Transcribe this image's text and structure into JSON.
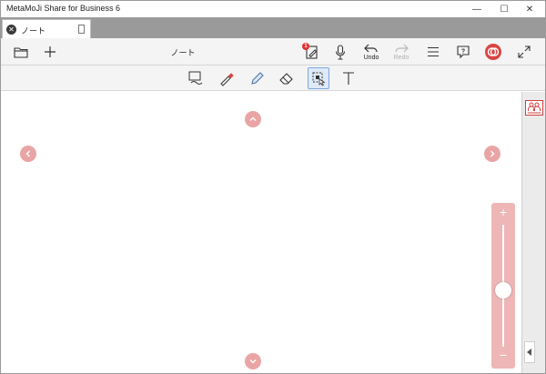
{
  "window": {
    "title": "MetaMoJi Share for Business 6",
    "minimize_glyph": "—",
    "maximize_glyph": "☐",
    "close_glyph": "✕"
  },
  "tab": {
    "label": "ノート",
    "close_glyph": "✕"
  },
  "toolbar": {
    "document_title": "ノート",
    "undo_label": "Undo",
    "redo_label": "Redo",
    "notification_count": "1",
    "icons": [
      "folder-icon",
      "plus-icon",
      "share-edit-icon",
      "microphone-icon",
      "undo-icon",
      "redo-icon",
      "menu-icon",
      "help-icon",
      "metamoji-logo-icon",
      "expand-icon"
    ]
  },
  "pen_tools": {
    "active": "lasso-select",
    "items": [
      "lasso-select",
      "marker",
      "pen",
      "eraser",
      "select-object",
      "text"
    ]
  },
  "canvas": {
    "nav": [
      "up",
      "left",
      "right",
      "down"
    ]
  },
  "zoom": {
    "plus_glyph": "+",
    "minus_glyph": "−",
    "level": 0.54
  },
  "colors": {
    "accent": "#e9a5a5",
    "tabbar": "#9a9a9a",
    "active_tool": "#7aa7e0",
    "brand_red": "#d94545"
  }
}
